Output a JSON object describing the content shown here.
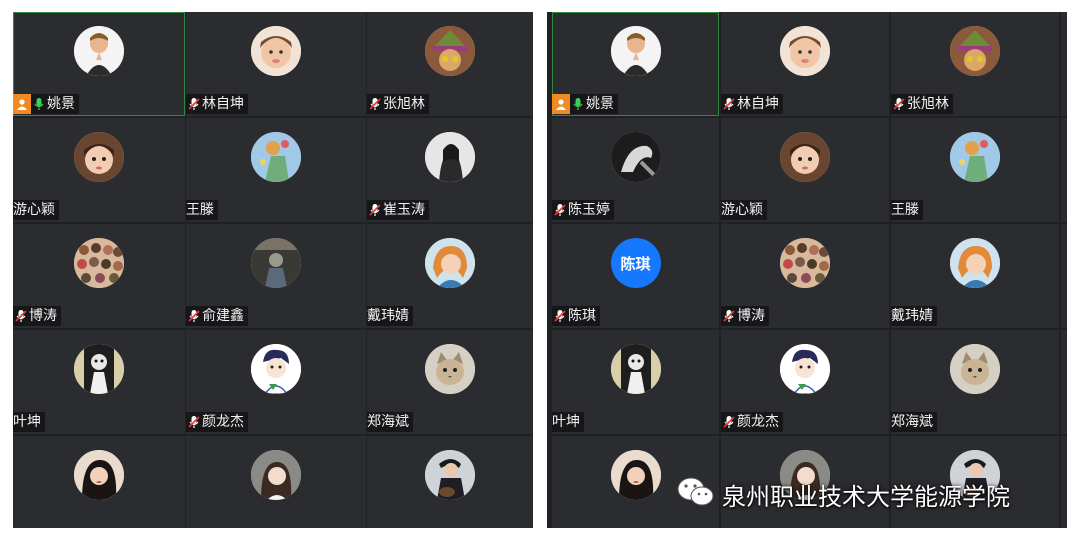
{
  "left_panel": {
    "tiles": [
      {
        "name": "姚景",
        "host": true,
        "mic": "on",
        "avatar": "photo-child-praying-icon",
        "active": true
      },
      {
        "name": "林自坤",
        "mic": "muted",
        "avatar": "photo-child-face-icon"
      },
      {
        "name": "张旭林",
        "mic": "muted",
        "avatar": "photo-green-hat-icon"
      },
      {
        "name": "游心颖",
        "avatar": "photo-girl-face-icon"
      },
      {
        "name": "王滕",
        "avatar": "photo-flower-drawing-icon"
      },
      {
        "name": "崔玉涛",
        "mic": "muted",
        "avatar": "photo-bw-portrait-icon"
      },
      {
        "name": "博涛",
        "mic": "muted",
        "avatar": "photo-crowd-icon"
      },
      {
        "name": "俞建鑫",
        "mic": "muted",
        "avatar": "photo-dark-figure-icon"
      },
      {
        "name": "戴玮婧",
        "avatar": "photo-orange-hair-icon"
      },
      {
        "name": "叶坤",
        "avatar": "photo-bw-poster-icon"
      },
      {
        "name": "颜龙杰",
        "mic": "muted",
        "avatar": "photo-cartoon-boy-icon"
      },
      {
        "name": "郑海斌",
        "avatar": "photo-cat-icon"
      },
      {
        "name": "",
        "avatar": "photo-woman-dark-icon"
      },
      {
        "name": "",
        "avatar": "photo-woman-light-icon"
      },
      {
        "name": "",
        "avatar": "photo-man-guitar-icon"
      }
    ]
  },
  "right_panel": {
    "tiles": [
      {
        "name": "姚景",
        "host": true,
        "mic": "on",
        "avatar": "photo-child-praying-icon",
        "active": true
      },
      {
        "name": "林自坤",
        "mic": "muted",
        "avatar": "photo-child-face-icon"
      },
      {
        "name": "张旭林",
        "mic": "muted",
        "avatar": "photo-green-hat-icon"
      },
      {
        "name": "",
        "avatar": "none"
      },
      {
        "name": "陈玉婷",
        "mic": "muted",
        "avatar": "photo-bw-hand-icon"
      },
      {
        "name": "游心颖",
        "avatar": "photo-girl-face-icon"
      },
      {
        "name": "王滕",
        "avatar": "photo-flower-drawing-icon"
      },
      {
        "name": "",
        "avatar": "none"
      },
      {
        "name": "陈琪",
        "mic": "muted",
        "avatar": "initials",
        "initials": "陈琪"
      },
      {
        "name": "博涛",
        "mic": "muted",
        "avatar": "photo-crowd-icon"
      },
      {
        "name": "戴玮婧",
        "avatar": "photo-orange-hair-icon"
      },
      {
        "name": "",
        "avatar": "none"
      },
      {
        "name": "叶坤",
        "avatar": "photo-bw-poster-icon"
      },
      {
        "name": "颜龙杰",
        "mic": "muted",
        "avatar": "photo-cartoon-boy-icon"
      },
      {
        "name": "郑海斌",
        "avatar": "photo-cat-icon"
      },
      {
        "name": "",
        "avatar": "none"
      },
      {
        "name": "",
        "avatar": "photo-woman-dark-icon"
      },
      {
        "name": "",
        "avatar": "photo-woman-light-icon"
      },
      {
        "name": "",
        "avatar": "photo-man-guitar-icon"
      },
      {
        "name": "",
        "avatar": "none"
      }
    ]
  },
  "watermark": {
    "text": "泉州职业技术大学能源学院",
    "icon": "wechat-icon"
  },
  "colors": {
    "panel_bg": "#202124",
    "tile_bg": "#2b2c2f",
    "active_border": "#2e8b3e",
    "host_badge": "#f08a24",
    "initials_bg": "#1677ff"
  }
}
